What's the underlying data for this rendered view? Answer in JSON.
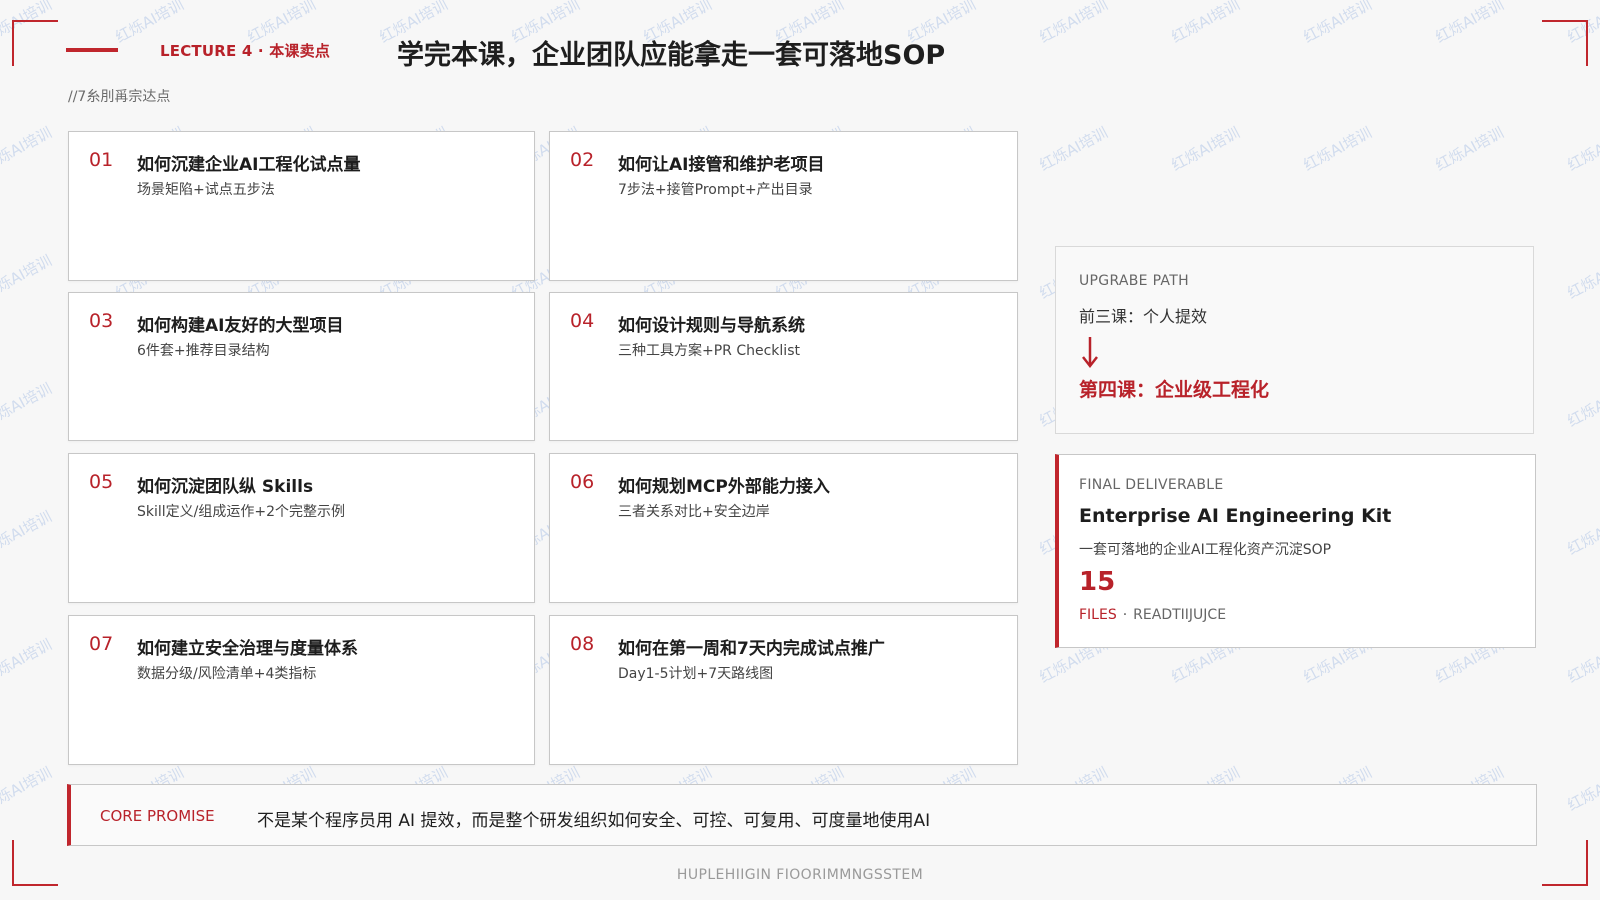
{
  "header": {
    "lecture_label": "LECTURE 4 · 本课卖点",
    "title": "学完本课，企业团队应能拿走一套可落地SOP",
    "sub_label": "//7糸刖爯宗达点"
  },
  "cards": [
    {
      "num": "01",
      "title": "如何沉建企业AI工程化试点量",
      "desc": "场景矩陷+试点五步法"
    },
    {
      "num": "02",
      "title": "如何让AI接管和维护老项目",
      "desc": "7步法+接管Prompt+产出目录"
    },
    {
      "num": "03",
      "title": "如何构建AI友好的大型项目",
      "desc": "6件套+推荐目录结构"
    },
    {
      "num": "04",
      "title": "如何设计规则与导航系统",
      "desc": "三种工具方案+PR Checklist"
    },
    {
      "num": "05",
      "title": "如何沉淀团队纵 Skills",
      "desc": "Skill定义/组成运作+2个完整示例"
    },
    {
      "num": "06",
      "title": "如何规划MCP外部能力接入",
      "desc": "三者关系对比+安全边岸"
    },
    {
      "num": "07",
      "title": "如何建立安全治理与度量体系",
      "desc": "数据分级/风险清单+4类指标"
    },
    {
      "num": "08",
      "title": "如何在第一周和7天内完成试点推广",
      "desc": "Day1-5计划+7天路线图"
    }
  ],
  "upgrade_path": {
    "eyebrow": "UPGRABE PATH",
    "from": "前三课：个人提效",
    "to": "第四课：企业级工程化"
  },
  "final_deliverable": {
    "eyebrow": "FINAL DELIVERABLE",
    "kit_title": "Enterprise AI Engineering Kit",
    "kit_desc": "一套可落地的企业AI工程化资产沉淀SOP",
    "count": "15",
    "files_label": "FILES",
    "separator": "·",
    "readme_label": "READTIIJUJCE"
  },
  "core_promise": {
    "label": "CORE PROMISE",
    "text": "不是某个程序员用 AI 提效，而是整个研发组织如何安全、可控、可复用、可度量地使用AI"
  },
  "footer": {
    "text": "HUPLEHIIGIN FIOORIMMNGSSTEM"
  },
  "watermark": {
    "text": "红烁AI培训"
  },
  "colors": {
    "accent": "#c0262d",
    "background": "#f7f7f7",
    "card_border": "#c7c7c7",
    "watermark": "#6e96d7"
  }
}
